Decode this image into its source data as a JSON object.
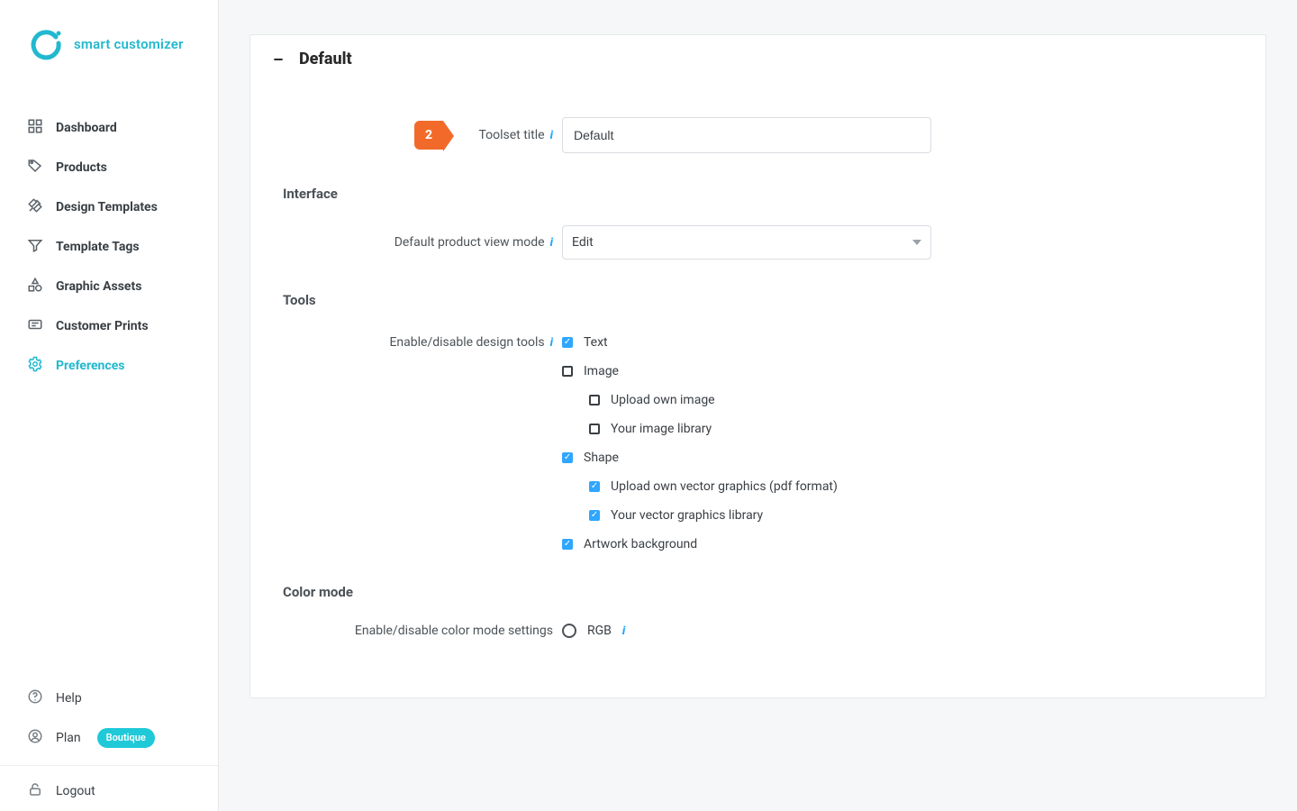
{
  "brand": {
    "app_name": "smart customizer"
  },
  "sidebar": {
    "items": [
      {
        "label": "Dashboard"
      },
      {
        "label": "Products"
      },
      {
        "label": "Design Templates"
      },
      {
        "label": "Template Tags"
      },
      {
        "label": "Graphic Assets"
      },
      {
        "label": "Customer Prints"
      },
      {
        "label": "Preferences"
      }
    ],
    "footer": {
      "help": "Help",
      "plan": "Plan",
      "plan_badge": "Boutique",
      "logout": "Logout"
    },
    "active_index": 6
  },
  "panel": {
    "title": "Default",
    "step": "2",
    "toolset_title_label": "Toolset title",
    "toolset_title_value": "Default",
    "sections": {
      "interface": {
        "title": "Interface",
        "default_view_label": "Default product view mode",
        "default_view_value": "Edit"
      },
      "tools": {
        "title": "Tools",
        "label": "Enable/disable design tools",
        "items": [
          {
            "label": "Text",
            "checked": true
          },
          {
            "label": "Image",
            "checked": false,
            "children": [
              {
                "label": "Upload own image",
                "checked": false
              },
              {
                "label": "Your image library",
                "checked": false
              }
            ]
          },
          {
            "label": "Shape",
            "checked": true,
            "children": [
              {
                "label": "Upload own vector graphics (pdf format)",
                "checked": true
              },
              {
                "label": "Your vector graphics library",
                "checked": true
              }
            ]
          },
          {
            "label": "Artwork background",
            "checked": true
          }
        ]
      },
      "color_mode": {
        "title": "Color mode",
        "label": "Enable/disable color mode settings",
        "options": [
          {
            "label": "RGB",
            "checked": false
          }
        ]
      }
    }
  },
  "icons": {
    "dashboard": "dashboard-icon",
    "tag": "tag-icon",
    "design": "design-templates-icon",
    "funnel": "funnel-icon",
    "shapes": "shapes-icon",
    "prints": "prints-icon",
    "gear": "gear-icon",
    "help": "help-icon",
    "user": "user-icon",
    "lock": "lock-icon",
    "minus": "minus-icon"
  },
  "colors": {
    "accent": "#22b8cf",
    "step": "#f26a2a",
    "link": "#1fa6ff"
  }
}
